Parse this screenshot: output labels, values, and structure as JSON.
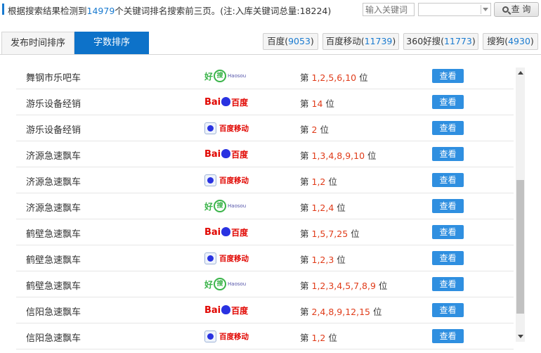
{
  "summary": {
    "prefix": "根据搜索结果检测到",
    "count": "14979",
    "middle": "个关键词排名搜索前三页。(注:入库关键词总量:",
    "total": "18224",
    "suffix": ")"
  },
  "search": {
    "placeholder": "输入关键词",
    "query_label": "查 询"
  },
  "tabs": [
    {
      "label": "发布时间排序",
      "active": false
    },
    {
      "label": "字数排序",
      "active": true
    }
  ],
  "engines": [
    {
      "name": "百度",
      "count": "9053"
    },
    {
      "name": "百度移动",
      "count": "11739"
    },
    {
      "name": "360好搜",
      "count": "11773"
    },
    {
      "name": "搜狗",
      "count": "4930"
    }
  ],
  "rank_prefix": "第",
  "rank_suffix": "位",
  "view_label": "查看",
  "rows": [
    {
      "keyword": "舞钢市乐吧车",
      "engine": "haosou",
      "positions": "1,2,5,6,10"
    },
    {
      "keyword": "游乐设备经销",
      "engine": "baidu",
      "positions": "14"
    },
    {
      "keyword": "游乐设备经销",
      "engine": "baidu-mobile",
      "positions": "2"
    },
    {
      "keyword": "济源急速飘车",
      "engine": "baidu",
      "positions": "1,3,4,8,9,10"
    },
    {
      "keyword": "济源急速飘车",
      "engine": "baidu-mobile",
      "positions": "1,2"
    },
    {
      "keyword": "济源急速飘车",
      "engine": "haosou",
      "positions": "1,2,4"
    },
    {
      "keyword": "鹤壁急速飘车",
      "engine": "baidu",
      "positions": "1,5,7,25"
    },
    {
      "keyword": "鹤壁急速飘车",
      "engine": "baidu-mobile",
      "positions": "1,2,3"
    },
    {
      "keyword": "鹤壁急速飘车",
      "engine": "haosou",
      "positions": "1,2,3,4,5,7,8,9"
    },
    {
      "keyword": "信阳急速飘车",
      "engine": "baidu",
      "positions": "2,4,8,9,12,15"
    },
    {
      "keyword": "信阳急速飘车",
      "engine": "baidu-mobile",
      "positions": "1,2"
    }
  ],
  "logos": {
    "haosou": {
      "cn_text": "好",
      "mark": "搜",
      "en_text": "Haosou"
    },
    "baidu": {
      "latin": "Bai",
      "cn": "百度"
    },
    "baidu-mobile": {
      "text": "百度移动"
    }
  },
  "colors": {
    "accent": "#0d72c9",
    "rank": "#e03c1a",
    "button": "#2f8fe0",
    "count": "#1a7bd0"
  }
}
